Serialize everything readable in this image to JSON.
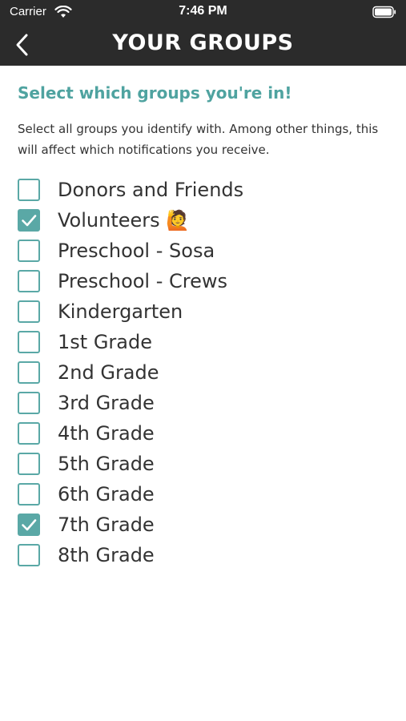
{
  "status_bar": {
    "carrier": "Carrier",
    "time": "7:46 PM",
    "icons": [
      "wifi-icon",
      "battery-icon"
    ]
  },
  "nav": {
    "back_icon": "chevron-left-icon",
    "title": "YOUR GROUPS"
  },
  "main": {
    "heading": "Select which groups you're in!",
    "description": "Select all groups you identify with. Among other things, this will affect which notifications you receive.",
    "groups": [
      {
        "label": "Donors and Friends",
        "checked": false
      },
      {
        "label": "Volunteers 🙋",
        "checked": true
      },
      {
        "label": "Preschool - Sosa",
        "checked": false
      },
      {
        "label": "Preschool - Crews",
        "checked": false
      },
      {
        "label": "Kindergarten",
        "checked": false
      },
      {
        "label": "1st Grade",
        "checked": false
      },
      {
        "label": "2nd Grade",
        "checked": false
      },
      {
        "label": "3rd Grade",
        "checked": false
      },
      {
        "label": "4th Grade",
        "checked": false
      },
      {
        "label": "5th Grade",
        "checked": false
      },
      {
        "label": "6th Grade",
        "checked": false
      },
      {
        "label": "7th Grade",
        "checked": true
      },
      {
        "label": "8th Grade",
        "checked": false
      }
    ]
  },
  "colors": {
    "accent": "#5aa8a6",
    "nav_background": "#2b2b2b",
    "heading": "#4fa3a0"
  }
}
